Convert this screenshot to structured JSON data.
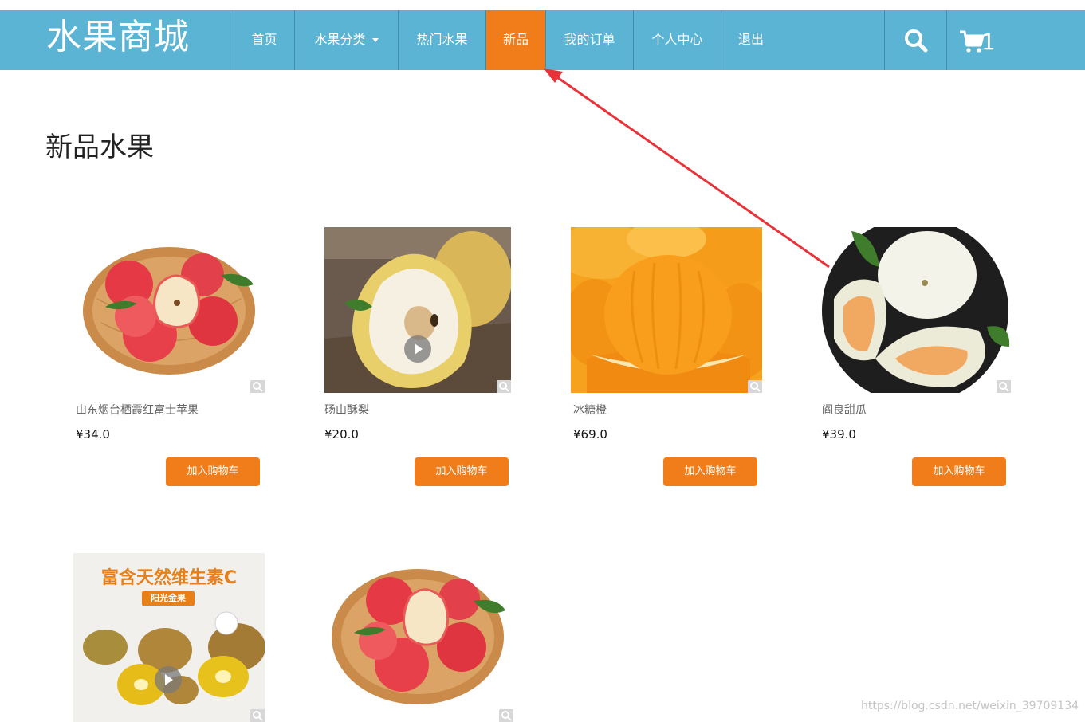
{
  "brand": "水果商城",
  "nav": {
    "home": "首页",
    "category": "水果分类",
    "hot": "热门水果",
    "new": "新品",
    "orders": "我的订单",
    "profile": "个人中心",
    "logout": "退出"
  },
  "cart_count": "1",
  "page_title": "新品水果",
  "products": [
    {
      "name": "山东烟台栖霞红富士苹果",
      "price": "¥34.0",
      "button": "加入购物车"
    },
    {
      "name": "砀山酥梨",
      "price": "¥20.0",
      "button": "加入购物车"
    },
    {
      "name": "冰糖橙",
      "price": "¥69.0",
      "button": "加入购物车"
    },
    {
      "name": "阎良甜瓜",
      "price": "¥39.0",
      "button": "加入购物车"
    }
  ],
  "kiwi_ad": {
    "headline": "富含天然维生素C",
    "tag": "阳光金果"
  },
  "watermark": "https://blog.csdn.net/weixin_39709134",
  "colors": {
    "navbar": "#5bb4d3",
    "accent": "#f07c1a",
    "annotation": "#e8333a"
  }
}
